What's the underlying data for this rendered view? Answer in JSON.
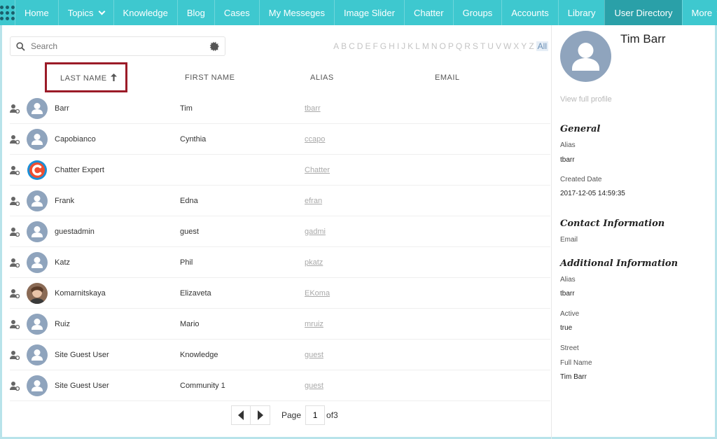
{
  "nav": {
    "items": [
      "Home",
      "Topics",
      "Knowledge",
      "Blog",
      "Cases",
      "My Messeges",
      "Image Slider",
      "Chatter",
      "Groups",
      "Accounts",
      "Library",
      "User Directory",
      "More"
    ],
    "active": "User Directory",
    "colors": {
      "bar": "#3ec8cf",
      "active": "#2aa0a8"
    }
  },
  "search": {
    "placeholder": "Search"
  },
  "alphabet": [
    "A",
    "B",
    "C",
    "D",
    "E",
    "F",
    "G",
    "H",
    "I",
    "J",
    "K",
    "L",
    "M",
    "N",
    "O",
    "P",
    "Q",
    "R",
    "S",
    "T",
    "U",
    "V",
    "W",
    "X",
    "Y",
    "Z",
    "All"
  ],
  "table": {
    "headers": {
      "last_name": "LAST NAME",
      "first_name": "FIRST NAME",
      "alias": "ALIAS",
      "email": "EMAIL"
    },
    "sort": {
      "column": "LAST NAME",
      "direction": "ascending"
    },
    "rows": [
      {
        "last": "Barr",
        "first": "Tim",
        "alias": "tbarr",
        "avatar": "default"
      },
      {
        "last": "Capobianco",
        "first": "Cynthia",
        "alias": "ccapo",
        "avatar": "default"
      },
      {
        "last": "Chatter Expert",
        "first": "",
        "alias": "Chatter",
        "avatar": "chatter"
      },
      {
        "last": "Frank",
        "first": "Edna",
        "alias": "efran",
        "avatar": "default"
      },
      {
        "last": "guestadmin",
        "first": "guest",
        "alias": "gadmi",
        "avatar": "default"
      },
      {
        "last": "Katz",
        "first": "Phil",
        "alias": "pkatz",
        "avatar": "default"
      },
      {
        "last": "Komarnitskaya",
        "first": "Elizaveta",
        "alias": "EKoma",
        "avatar": "photo"
      },
      {
        "last": "Ruiz",
        "first": "Mario",
        "alias": "mruiz",
        "avatar": "default"
      },
      {
        "last": "Site Guest User",
        "first": "Knowledge",
        "alias": "guest",
        "avatar": "default"
      },
      {
        "last": "Site Guest User",
        "first": "Community 1",
        "alias": "guest",
        "avatar": "default"
      }
    ]
  },
  "pager": {
    "label": "Page",
    "current": "1",
    "total_label": "of3"
  },
  "detail": {
    "name": "Tim Barr",
    "view_profile": "View full profile",
    "general_title": "General",
    "alias_label": "Alias",
    "alias_value": "tbarr",
    "created_label": "Created Date",
    "created_value": "2017-12-05 14:59:35",
    "contact_title": "Contact Information",
    "email_label": "Email",
    "additional_title": "Additional Information",
    "add_alias_label": "Alias",
    "add_alias_value": "tbarr",
    "active_label": "Active",
    "active_value": "true",
    "street_label": "Street",
    "fullname_label": "Full Name",
    "fullname_value": "Tim Barr"
  }
}
